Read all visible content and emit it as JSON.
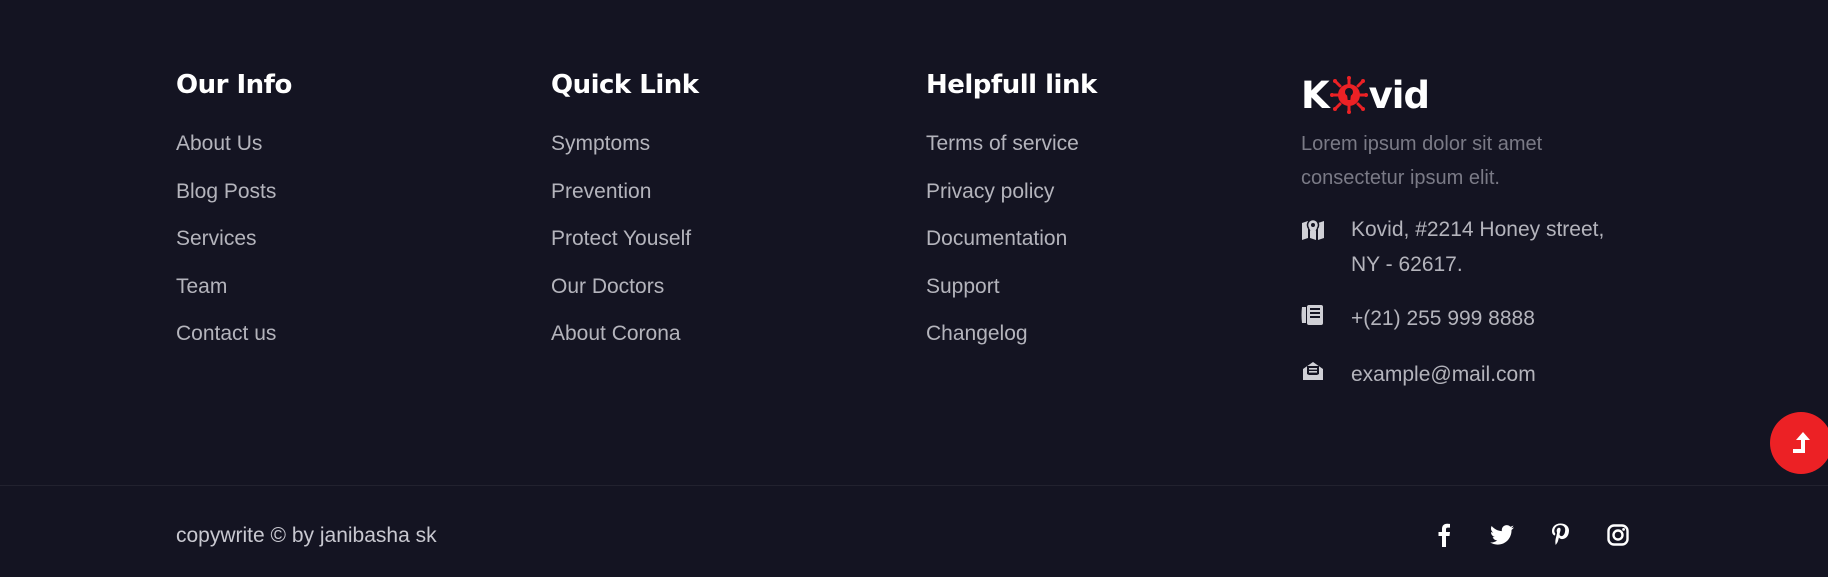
{
  "columns": [
    {
      "title": "Our Info",
      "links": [
        "About Us",
        "Blog Posts",
        "Services",
        "Team",
        "Contact us"
      ]
    },
    {
      "title": "Quick Link",
      "links": [
        "Symptoms",
        "Prevention",
        "Protect Youself",
        "Our Doctors",
        "About Corona"
      ]
    },
    {
      "title": "Helpfull link",
      "links": [
        "Terms of service",
        "Privacy policy",
        "Documentation",
        "Support",
        "Changelog"
      ]
    }
  ],
  "brand": {
    "logo_left": "K",
    "logo_right": "vid",
    "description_line1": "Lorem ipsum dolor sit amet",
    "description_line2": "consectetur ipsum elit.",
    "address_line1": "Kovid, #2214 Honey street,",
    "address_line2": "NY - 62617.",
    "phone": "+(21) 255 999 8888",
    "email": "example@mail.com",
    "accent_color": "#ec2125"
  },
  "bottom": {
    "copyright": "copywrite © by janibasha sk",
    "social_icons": [
      "facebook-icon",
      "twitter-icon",
      "pinterest-icon",
      "instagram-icon"
    ]
  }
}
